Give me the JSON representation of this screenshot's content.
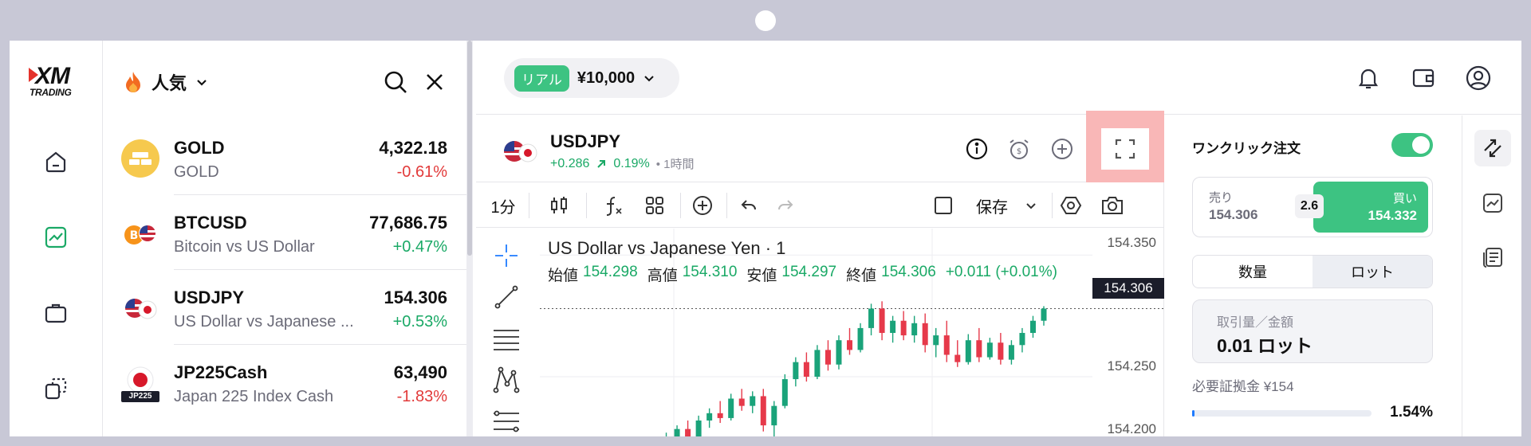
{
  "brand": {
    "logo_main": "XM",
    "logo_sub": "TRADING"
  },
  "nav": {
    "items": [
      {
        "icon": "home-icon",
        "active": false
      },
      {
        "icon": "chart-icon",
        "active": true
      },
      {
        "icon": "briefcase-icon",
        "active": false
      },
      {
        "icon": "copy-icon",
        "active": false
      }
    ]
  },
  "watchlist": {
    "title": "人気",
    "items": [
      {
        "symbol": "GOLD",
        "name": "GOLD",
        "price": "4,322.18",
        "change": "-0.61%",
        "direction": "down"
      },
      {
        "symbol": "BTCUSD",
        "name": "Bitcoin vs US Dollar",
        "price": "77,686.75",
        "change": "+0.47%",
        "direction": "up"
      },
      {
        "symbol": "USDJPY",
        "name": "US Dollar vs Japanese ...",
        "price": "154.306",
        "change": "+0.53%",
        "direction": "up"
      },
      {
        "symbol": "JP225Cash",
        "name": "Japan 225 Index Cash",
        "price": "63,490",
        "change": "-1.83%",
        "direction": "down",
        "badge": "JP225"
      }
    ]
  },
  "account": {
    "type": "リアル",
    "balance": "¥10,000"
  },
  "instrument": {
    "symbol": "USDJPY",
    "change": "+0.286",
    "change_pct": "0.19%",
    "timeframe_label": "• 1時間"
  },
  "toolbar": {
    "interval": "1分",
    "save": "保存"
  },
  "chart": {
    "title": "US Dollar vs Japanese Yen · 1",
    "open_label": "始値",
    "open": "154.298",
    "high_label": "高値",
    "high": "154.310",
    "low_label": "安値",
    "low": "154.297",
    "close_label": "終値",
    "close": "154.306",
    "change": "+0.011 (+0.01%)",
    "current_price": "154.306",
    "y_ticks": [
      "154.350",
      "154.250",
      "154.200"
    ]
  },
  "chart_data": {
    "type": "candlestick",
    "title": "US Dollar vs Japanese Yen · 1",
    "ylim": [
      154.195,
      154.36
    ],
    "y_ticks": [
      154.35,
      154.25,
      154.2
    ],
    "current_price": 154.306,
    "candles": [
      [
        154.196,
        154.2,
        154.19,
        154.198
      ],
      [
        154.198,
        154.204,
        154.194,
        154.2
      ],
      [
        154.2,
        154.21,
        154.197,
        154.207
      ],
      [
        154.207,
        154.214,
        154.198,
        154.2
      ],
      [
        154.2,
        154.218,
        154.199,
        154.214
      ],
      [
        154.214,
        154.224,
        154.208,
        154.22
      ],
      [
        154.22,
        154.23,
        154.212,
        154.216
      ],
      [
        154.216,
        154.236,
        154.214,
        154.232
      ],
      [
        154.232,
        154.24,
        154.222,
        154.226
      ],
      [
        154.226,
        154.238,
        154.22,
        154.234
      ],
      [
        154.234,
        154.24,
        154.205,
        154.21
      ],
      [
        154.21,
        154.23,
        154.2,
        154.226
      ],
      [
        154.226,
        154.252,
        154.224,
        154.248
      ],
      [
        154.248,
        154.266,
        154.242,
        154.262
      ],
      [
        154.262,
        154.27,
        154.246,
        154.25
      ],
      [
        154.25,
        154.276,
        154.248,
        154.272
      ],
      [
        154.272,
        154.28,
        154.255,
        154.26
      ],
      [
        154.26,
        154.284,
        154.256,
        154.28
      ],
      [
        154.28,
        154.29,
        154.268,
        154.272
      ],
      [
        154.272,
        154.294,
        154.27,
        154.29
      ],
      [
        154.29,
        154.31,
        154.284,
        154.306
      ],
      [
        154.306,
        154.312,
        154.28,
        154.286
      ],
      [
        154.286,
        154.3,
        154.278,
        154.296
      ],
      [
        154.296,
        154.304,
        154.28,
        154.284
      ],
      [
        154.284,
        154.3,
        154.278,
        154.294
      ],
      [
        154.294,
        154.302,
        154.27,
        154.276
      ],
      [
        154.276,
        154.29,
        154.266,
        154.284
      ],
      [
        154.284,
        154.296,
        154.262,
        154.268
      ],
      [
        154.268,
        154.28,
        154.258,
        154.262
      ],
      [
        154.262,
        154.285,
        154.26,
        154.28
      ],
      [
        154.28,
        154.29,
        154.262,
        154.266
      ],
      [
        154.266,
        154.282,
        154.264,
        154.278
      ],
      [
        154.278,
        154.286,
        154.26,
        154.264
      ],
      [
        154.264,
        154.28,
        154.26,
        154.276
      ],
      [
        154.276,
        154.29,
        154.27,
        154.286
      ],
      [
        154.286,
        154.3,
        154.282,
        154.296
      ],
      [
        154.296,
        154.308,
        154.292,
        154.306
      ]
    ]
  },
  "order": {
    "one_click_label": "ワンクリック注文",
    "sell_label": "売り",
    "sell_price": "154.306",
    "spread": "2.6",
    "buy_label": "買い",
    "buy_price": "154.332",
    "tab_qty": "数量",
    "tab_lot": "ロット",
    "amount_label": "取引量／金額",
    "amount_value": "0.01 ロット",
    "margin_label": "必要証拠金 ¥154",
    "margin_pct": "1.54%",
    "margin_fraction": 0.0154
  }
}
